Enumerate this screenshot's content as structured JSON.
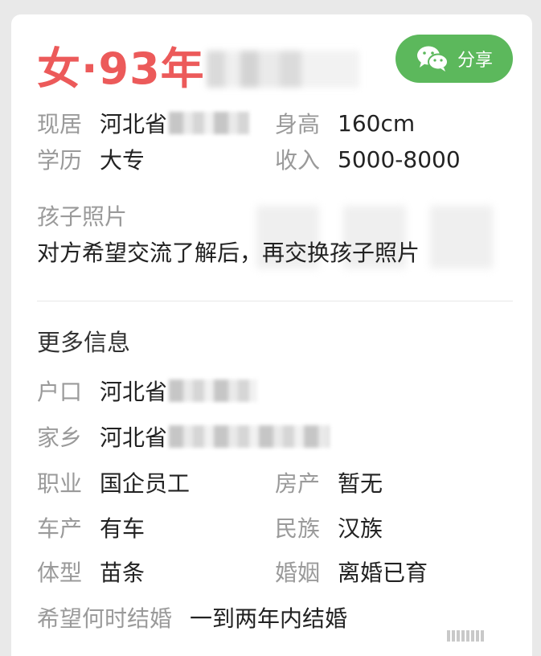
{
  "header": {
    "title": "女·93年",
    "share_label": "分享"
  },
  "basic": {
    "residence_label": "现居",
    "residence_value": "河北省",
    "height_label": "身高",
    "height_value": "160cm",
    "education_label": "学历",
    "education_value": "大专",
    "income_label": "收入",
    "income_value": "5000-8000"
  },
  "child_photo": {
    "label": "孩子照片",
    "note": "对方希望交流了解后，再交换孩子照片"
  },
  "more_info": {
    "title": "更多信息",
    "hukou_label": "户口",
    "hukou_value": "河北省",
    "hometown_label": "家乡",
    "hometown_value": "河北省",
    "job_label": "职业",
    "job_value": "国企员工",
    "property_label": "房产",
    "property_value": "暂无",
    "car_label": "车产",
    "car_value": "有车",
    "ethnic_label": "民族",
    "ethnic_value": "汉族",
    "body_label": "体型",
    "body_value": "苗条",
    "marriage_label": "婚姻",
    "marriage_value": "离婚已育",
    "wedding_label": "希望何时结婚",
    "wedding_value": "一到两年内结婚"
  },
  "colors": {
    "accent": "#ec5a5a",
    "share_green": "#5cb85c",
    "label_gray": "#9a9a9a",
    "value_dark": "#222222"
  }
}
